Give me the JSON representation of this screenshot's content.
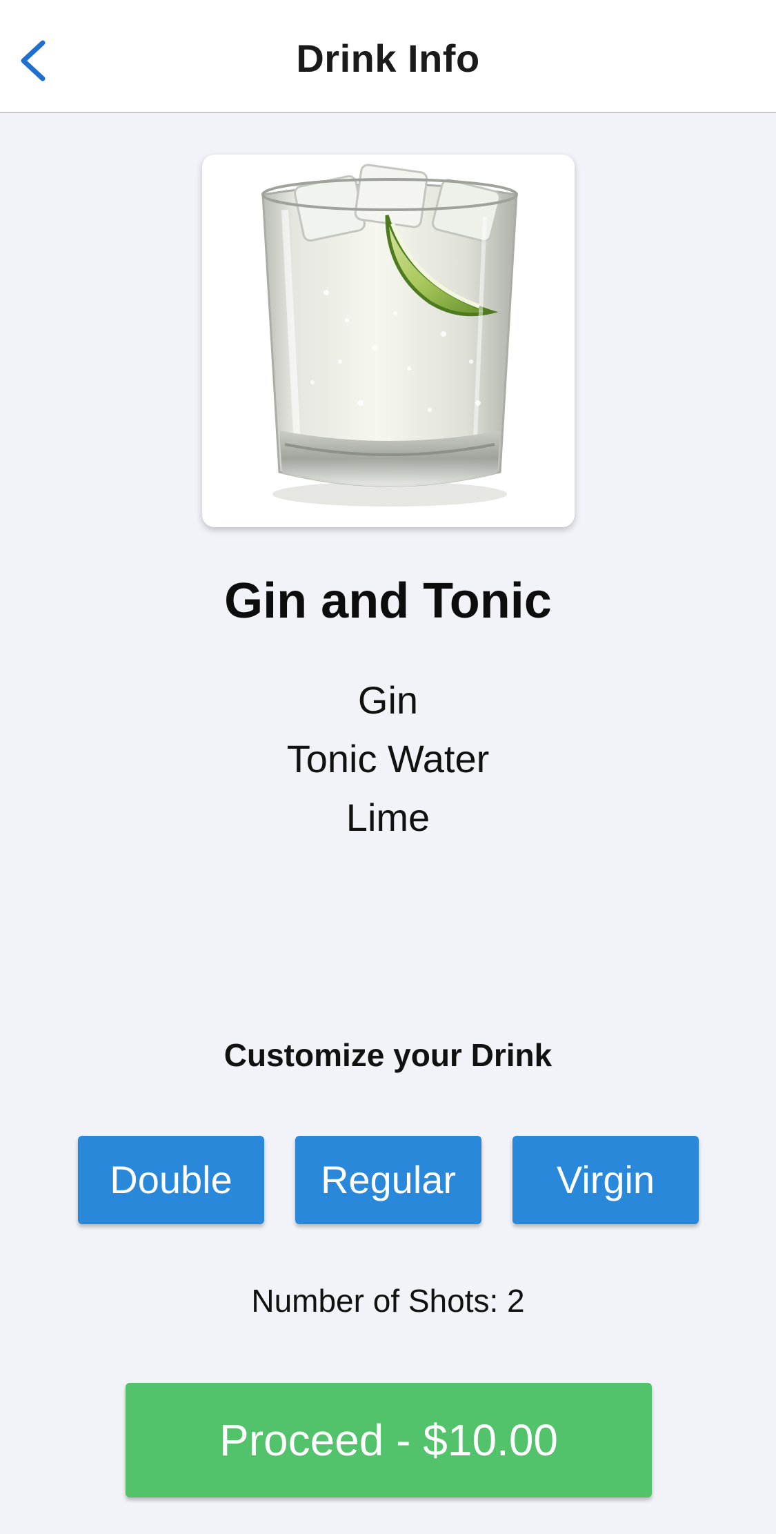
{
  "header": {
    "title": "Drink Info",
    "back_icon": "chevron-left-icon"
  },
  "drink": {
    "name": "Gin and Tonic",
    "ingredients": [
      "Gin",
      "Tonic Water",
      "Lime"
    ]
  },
  "customize": {
    "heading": "Customize your Drink",
    "options": [
      "Double",
      "Regular",
      "Virgin"
    ]
  },
  "shots_text": "Number of Shots: 2",
  "proceed_label": "Proceed - $10.00",
  "colors": {
    "accent_blue": "#2a88db",
    "proceed_green": "#52c26b",
    "back_icon_blue": "#1f6fd0",
    "background": "#f2f3f8"
  }
}
